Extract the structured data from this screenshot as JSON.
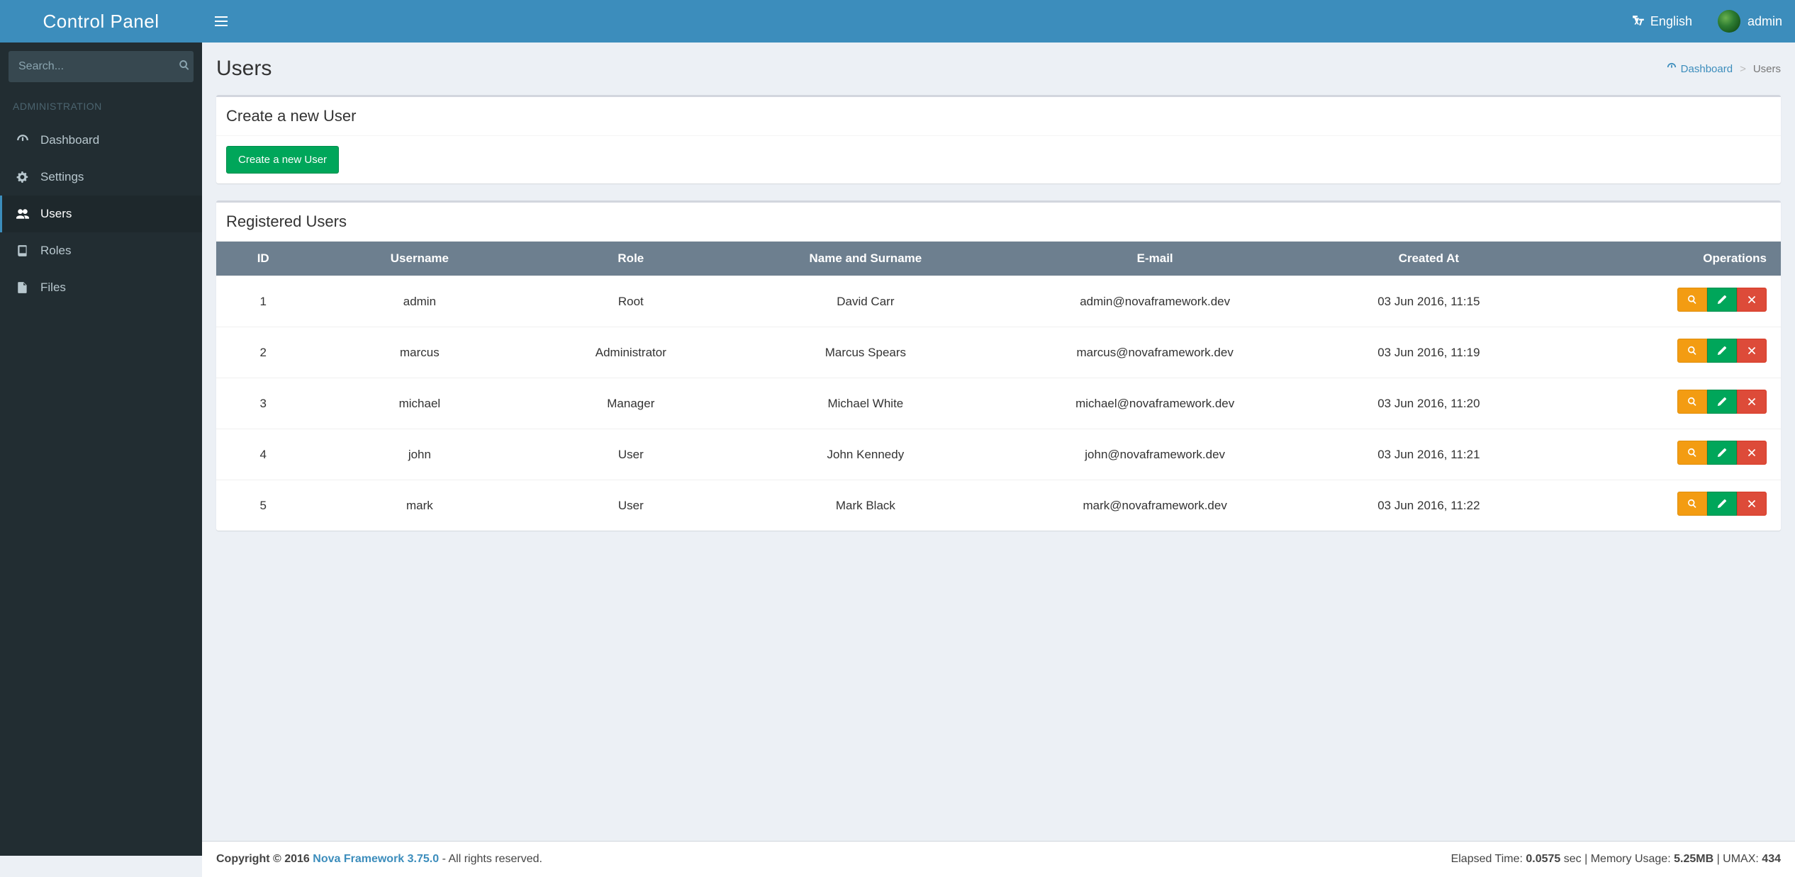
{
  "brand": "Control Panel",
  "search": {
    "placeholder": "Search..."
  },
  "nav": {
    "language": "English",
    "username": "admin"
  },
  "sidebar": {
    "section": "ADMINISTRATION",
    "items": [
      {
        "label": "Dashboard"
      },
      {
        "label": "Settings"
      },
      {
        "label": "Users"
      },
      {
        "label": "Roles"
      },
      {
        "label": "Files"
      }
    ]
  },
  "page": {
    "title": "Users",
    "breadcrumb": {
      "home": "Dashboard",
      "current": "Users"
    }
  },
  "create_box": {
    "title": "Create a new User",
    "button": "Create a new User"
  },
  "list_box": {
    "title": "Registered Users",
    "columns": {
      "id": "ID",
      "username": "Username",
      "role": "Role",
      "name": "Name and Surname",
      "email": "E-mail",
      "created": "Created At",
      "ops": "Operations"
    },
    "rows": [
      {
        "id": "1",
        "username": "admin",
        "role": "Root",
        "name": "David Carr",
        "email": "admin@novaframework.dev",
        "created": "03 Jun 2016, 11:15"
      },
      {
        "id": "2",
        "username": "marcus",
        "role": "Administrator",
        "name": "Marcus Spears",
        "email": "marcus@novaframework.dev",
        "created": "03 Jun 2016, 11:19"
      },
      {
        "id": "3",
        "username": "michael",
        "role": "Manager",
        "name": "Michael White",
        "email": "michael@novaframework.dev",
        "created": "03 Jun 2016, 11:20"
      },
      {
        "id": "4",
        "username": "john",
        "role": "User",
        "name": "John Kennedy",
        "email": "john@novaframework.dev",
        "created": "03 Jun 2016, 11:21"
      },
      {
        "id": "5",
        "username": "mark",
        "role": "User",
        "name": "Mark Black",
        "email": "mark@novaframework.dev",
        "created": "03 Jun 2016, 11:22"
      }
    ]
  },
  "footer": {
    "copyright_prefix": "Copyright © 2016 ",
    "link": "Nova Framework 3.75.0",
    "copyright_suffix": " - All rights reserved.",
    "right_prefix": "Elapsed Time: ",
    "elapsed": "0.0575",
    "right_mid1": " sec | Memory Usage: ",
    "memory": "5.25MB",
    "right_mid2": " | UMAX: ",
    "umax": "434"
  }
}
